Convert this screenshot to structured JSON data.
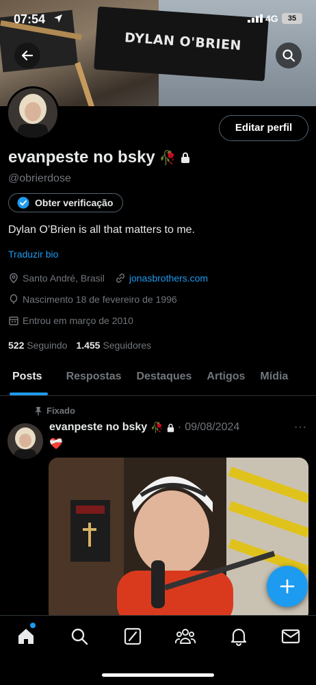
{
  "status_bar": {
    "time": "07:54",
    "network": "4G",
    "battery": "35",
    "icons": [
      "location-arrow-icon",
      "signal-icon"
    ]
  },
  "banner": {
    "chair_text": "DYLAN O'BRIEN"
  },
  "profile": {
    "edit_label": "Editar perfil",
    "display_name": "evanpeste no bsky",
    "name_emoji": "🥀",
    "handle": "@obrierdose",
    "verify_label": "Obter verificação",
    "bio": "Dylan O’Brien is all that matters to me.",
    "translate_label": "Traduzir bio",
    "location": "Santo André, Brasil",
    "website": "jonasbrothers.com",
    "birth": "Nascimento 18 de fevereiro de 1996",
    "joined": "Entrou em março de 2010",
    "following_count": "522",
    "following_label": "Seguindo",
    "followers_count": "1.455",
    "followers_label": "Seguidores"
  },
  "tabs": [
    {
      "label": "Posts",
      "active": true
    },
    {
      "label": "Respostas",
      "active": false
    },
    {
      "label": "Destaques",
      "active": false
    },
    {
      "label": "Artigos",
      "active": false
    },
    {
      "label": "Mídia",
      "active": false
    }
  ],
  "post": {
    "pinned_label": "Fixado",
    "author": "evanpeste no bsky",
    "author_emoji": "🥀",
    "separator": "·",
    "date": "09/08/2024",
    "more": "···",
    "text": "❤️‍🩹"
  },
  "colors": {
    "accent": "#1d9bf0",
    "background": "#000000",
    "text_primary": "#e7e9ea",
    "text_secondary": "#71767b",
    "border": "#2f3336"
  },
  "nav": [
    "home-icon",
    "search-icon",
    "grok-icon",
    "communities-icon",
    "notifications-icon",
    "messages-icon"
  ]
}
